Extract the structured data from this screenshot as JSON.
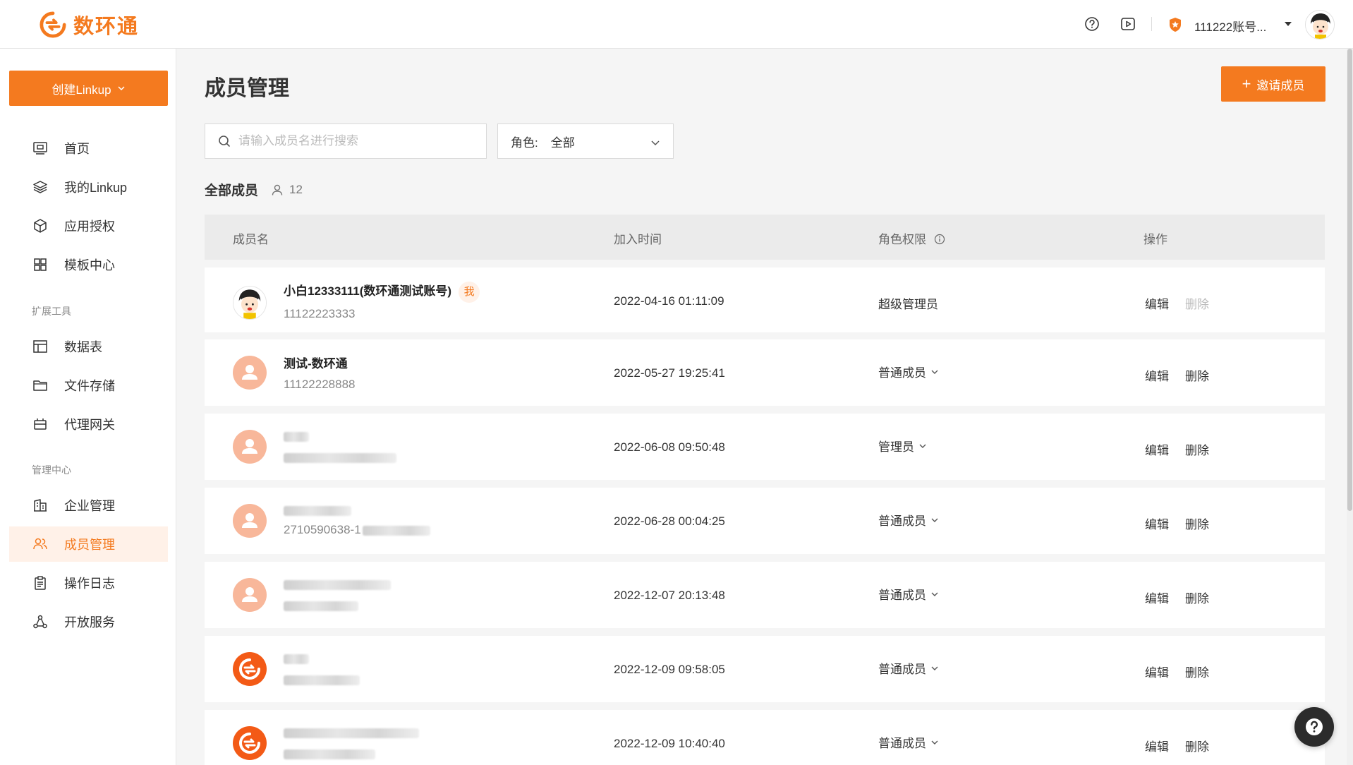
{
  "brand": {
    "name": "数环通",
    "color": "#f47a1f"
  },
  "header": {
    "help_icon": "question-circle-icon",
    "video_icon": "play-square-icon",
    "account_name": "111222账号...",
    "account_badge_icon": "shield-star-icon"
  },
  "sidebar": {
    "create_label": "创建Linkup",
    "items_main": [
      {
        "label": "首页",
        "icon": "monitor-icon"
      },
      {
        "label": "我的Linkup",
        "icon": "layers-icon"
      },
      {
        "label": "应用授权",
        "icon": "cube-icon"
      },
      {
        "label": "模板中心",
        "icon": "grid-icon"
      }
    ],
    "section_ext": "扩展工具",
    "items_ext": [
      {
        "label": "数据表",
        "icon": "table-icon"
      },
      {
        "label": "文件存储",
        "icon": "folder-icon"
      },
      {
        "label": "代理网关",
        "icon": "gateway-icon"
      }
    ],
    "section_admin": "管理中心",
    "items_admin": [
      {
        "label": "企业管理",
        "icon": "building-icon"
      },
      {
        "label": "成员管理",
        "icon": "users-icon",
        "active": true
      },
      {
        "label": "操作日志",
        "icon": "clipboard-icon"
      },
      {
        "label": "开放服务",
        "icon": "share-icon"
      }
    ]
  },
  "page": {
    "title": "成员管理",
    "invite_label": "邀请成员",
    "search_placeholder": "请输入成员名进行搜索",
    "role_filter_label": "角色:",
    "role_filter_value": "全部",
    "all_members_label": "全部成员",
    "member_count": "12"
  },
  "table": {
    "columns": [
      "成员名",
      "加入时间",
      "角色权限",
      "操作"
    ],
    "edit_label": "编辑",
    "delete_label": "删除",
    "me_tag": "我",
    "rows": [
      {
        "name": "小白12333111(数环通测试账号)",
        "phone": "11122223333",
        "time": "2022-04-16 01:11:09",
        "role": "超级管理员",
        "avatar": "cartoon",
        "is_me": true,
        "dropdown": false,
        "delete_disabled": true
      },
      {
        "name": "测试-数环通",
        "phone": "11122228888",
        "time": "2022-05-27 19:25:41",
        "role": "普通成员",
        "avatar": "peach",
        "is_me": false,
        "dropdown": true,
        "delete_disabled": false
      },
      {
        "name": "",
        "phone": "",
        "time": "2022-06-08 09:50:48",
        "role": "管理员",
        "avatar": "peach",
        "is_me": false,
        "dropdown": true,
        "delete_disabled": false,
        "blurred": true
      },
      {
        "name": "",
        "phone": "2710590638-1",
        "time": "2022-06-28 00:04:25",
        "role": "普通成员",
        "avatar": "peach",
        "is_me": false,
        "dropdown": true,
        "delete_disabled": false,
        "blurred": true
      },
      {
        "name": "",
        "phone": "",
        "time": "2022-12-07 20:13:48",
        "role": "普通成员",
        "avatar": "peach",
        "is_me": false,
        "dropdown": true,
        "delete_disabled": false,
        "blurred": true
      },
      {
        "name": "",
        "phone": "",
        "time": "2022-12-09 09:58:05",
        "role": "普通成员",
        "avatar": "logo",
        "is_me": false,
        "dropdown": true,
        "delete_disabled": false,
        "blurred": true
      },
      {
        "name": "",
        "phone": "",
        "time": "2022-12-09 10:40:40",
        "role": "普通成员",
        "avatar": "logo",
        "is_me": false,
        "dropdown": true,
        "delete_disabled": false,
        "blurred": true
      }
    ]
  },
  "colors": {
    "accent": "#f47a1f",
    "active_bg": "#fff1e8",
    "avatar_peach": "#f8b79a",
    "header_bg": "#ebebeb"
  }
}
